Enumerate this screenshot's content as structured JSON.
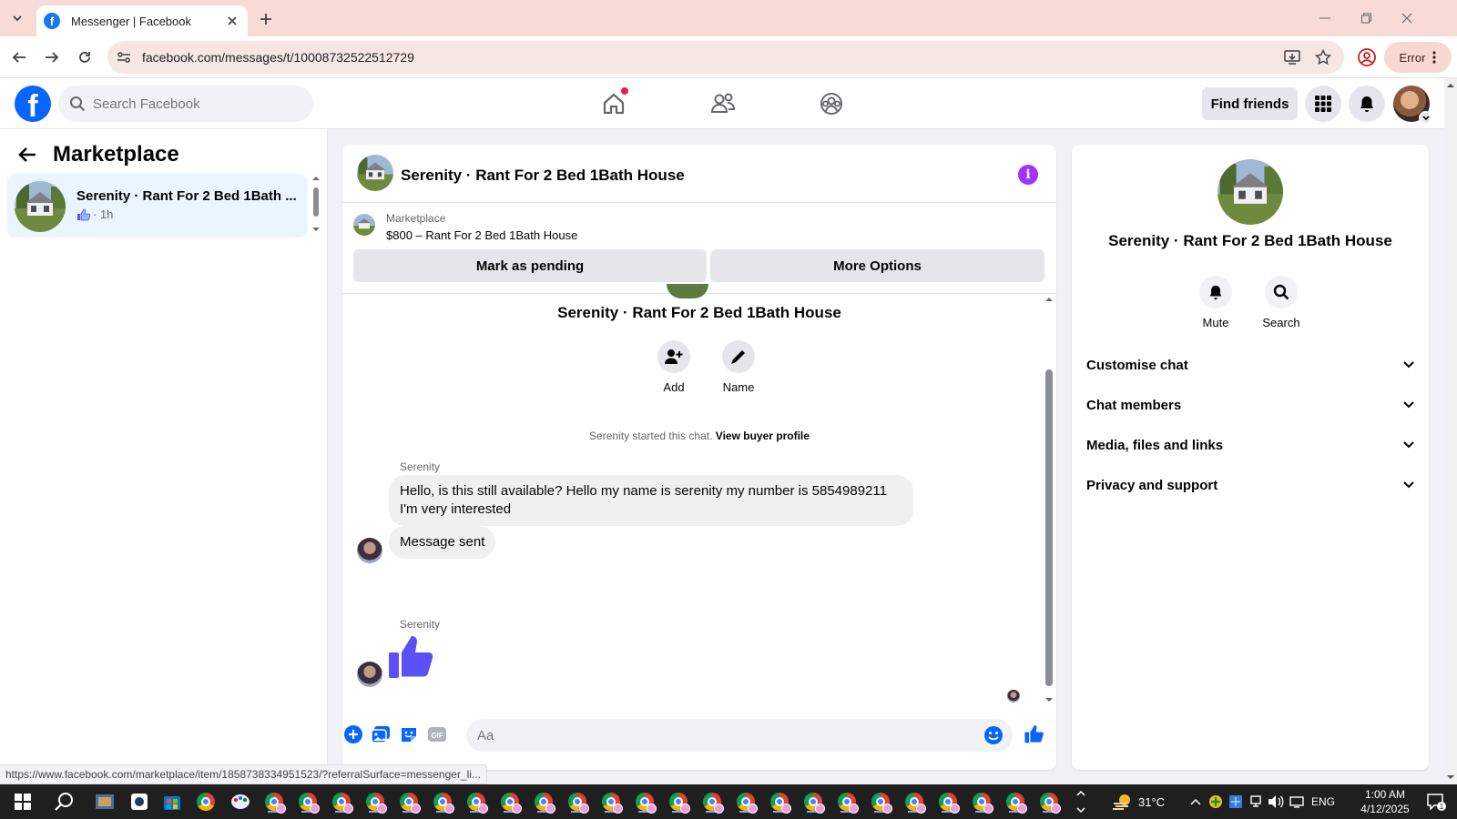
{
  "browser": {
    "tab_title": "Messenger | Facebook",
    "url": "facebook.com/messages/t/10008732522512729",
    "profile_chip": "Error"
  },
  "fb_nav": {
    "logo": "f",
    "search_placeholder": "Search Facebook",
    "find_friends": "Find friends"
  },
  "left_panel": {
    "title": "Marketplace",
    "conversations": [
      {
        "title": "Serenity · Rant For 2 Bed 1Bath ...",
        "meta": "· 1h"
      }
    ]
  },
  "chat": {
    "header_title": "Serenity · Rant For 2 Bed 1Bath House",
    "listing_source": "Marketplace",
    "listing_price_title": "$800 – Rant For 2 Bed 1Bath House",
    "mark_pending": "Mark as pending",
    "more_options": "More Options",
    "group_title": "Serenity · Rant For 2 Bed 1Bath House",
    "actions": [
      {
        "label": "Add",
        "icon": "add-person-icon"
      },
      {
        "label": "Name",
        "icon": "pencil-icon"
      }
    ],
    "started_text": "Serenity started this chat.",
    "view_profile": "View buyer profile",
    "messages": [
      {
        "sender": "Serenity",
        "text": "Hello, is this still available? Hello my name is serenity my number is 5854989211 I'm very interested"
      },
      {
        "sender": "",
        "text": "Message sent"
      },
      {
        "sender": "Serenity",
        "text": "",
        "sticker": "thumbs-up"
      }
    ],
    "composer_placeholder": "Aa"
  },
  "right_panel": {
    "name": "Serenity · Rant For 2 Bed 1Bath House",
    "actions": [
      {
        "label": "Mute",
        "icon": "bell-icon"
      },
      {
        "label": "Search",
        "icon": "search-icon"
      }
    ],
    "sections": [
      "Customise chat",
      "Chat members",
      "Media, files and links",
      "Privacy and support"
    ]
  },
  "status_url": "https://www.facebook.com/marketplace/item/1858738334951523/?referralSurface=messenger_li...",
  "taskbar": {
    "weather": "31°C",
    "language": "ENG",
    "time": "1:00 AM",
    "date": "4/12/2025",
    "notification_count": "1"
  },
  "colors": {
    "fb_blue": "#0866ff",
    "messenger_accent": "#5b4ff5",
    "info_purple": "#a033ff",
    "tab_bar": "#f9dbd5"
  }
}
